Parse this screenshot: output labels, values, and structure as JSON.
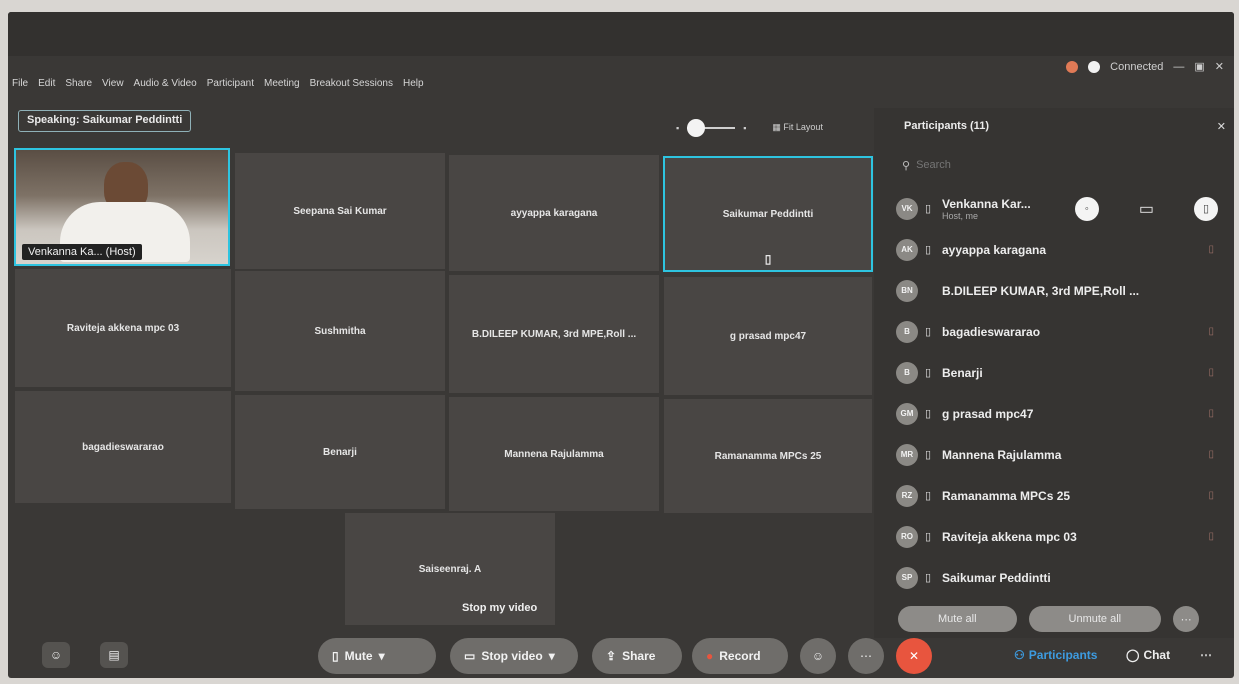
{
  "window": {
    "menu": [
      "File",
      "Edit",
      "Share",
      "View",
      "Audio & Video",
      "Participant",
      "Meeting",
      "Breakout Sessions",
      "Help"
    ],
    "connected_label": "Connected"
  },
  "speaking": {
    "prefix": "Speaking:",
    "name": "Saikumar Peddintti"
  },
  "layout": {
    "fit_label": "Fit Layout"
  },
  "self_tile": {
    "label": "Venkanna Ka... (Host)"
  },
  "tiles": [
    {
      "name": "Seepana Sai Kumar"
    },
    {
      "name": "ayyappa karagana"
    },
    {
      "name": "Saikumar Peddintti"
    },
    {
      "name": "Raviteja akkena mpc 03"
    },
    {
      "name": "Sushmitha"
    },
    {
      "name": "B.DILEEP KUMAR, 3rd MPE,Roll ..."
    },
    {
      "name": "g prasad mpc47"
    },
    {
      "name": "bagadieswararao"
    },
    {
      "name": "Benarji"
    },
    {
      "name": "Mannena Rajulamma"
    },
    {
      "name": "Ramanamma MPCs 25"
    },
    {
      "name": "Saiseenraj. A"
    }
  ],
  "panel": {
    "title": "Participants (11)",
    "search_placeholder": "Search",
    "participants": [
      {
        "initials": "VK",
        "name": "Venkanna Kar...",
        "role": "Host, me"
      },
      {
        "initials": "AK",
        "name": "ayyappa karagana"
      },
      {
        "initials": "BN",
        "name": "B.DILEEP KUMAR, 3rd MPE,Roll ..."
      },
      {
        "initials": "B",
        "name": "bagadieswararao"
      },
      {
        "initials": "B",
        "name": "Benarji"
      },
      {
        "initials": "GM",
        "name": "g prasad mpc47"
      },
      {
        "initials": "MR",
        "name": "Mannena Rajulamma"
      },
      {
        "initials": "RZ",
        "name": "Ramanamma MPCs 25"
      },
      {
        "initials": "RO",
        "name": "Raviteja akkena mpc 03"
      },
      {
        "initials": "SP",
        "name": "Saikumar Peddintti"
      }
    ],
    "mute_all": "Mute all",
    "unmute_all": "Unmute all"
  },
  "toolbar": {
    "tooltip": "Stop my video",
    "mute": "Mute",
    "stop_video": "Stop video",
    "share": "Share",
    "record": "Record",
    "participants": "Participants",
    "chat": "Chat"
  },
  "colors": {
    "active_border": "#2ec4e0",
    "end_button": "#e8553e"
  }
}
